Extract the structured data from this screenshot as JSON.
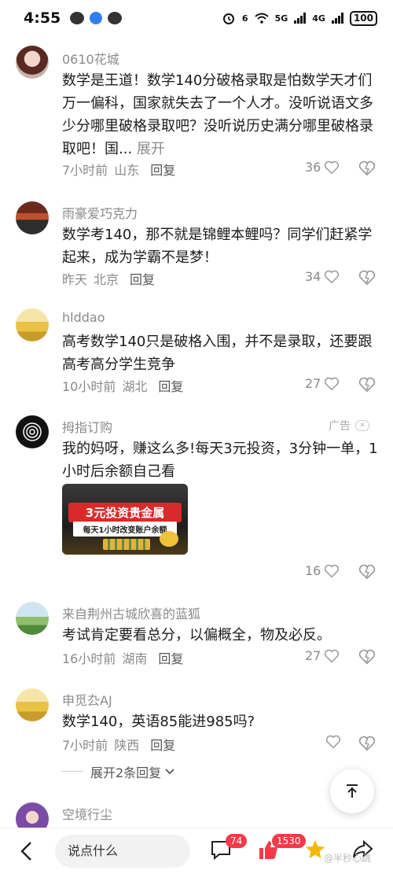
{
  "status_bar": {
    "time": "4:55",
    "network1": "6",
    "network2": "5G",
    "network3": "4G",
    "battery": "100"
  },
  "comments": [
    {
      "user": "0610花城",
      "text": "数学是王道！数学140分破格录取是怕数学天才们万一偏科，国家就失去了一个人才。没听说语文多少分哪里破格录取吧？没听说历史满分哪里破格录取吧！国...",
      "expand": "展开",
      "time": "7小时前",
      "location": "山东",
      "reply": "回复",
      "likes": "36"
    },
    {
      "user": "雨豪爱巧克力",
      "text": "数学考140，那不就是锦鲤本鲤吗？同学们赶紧学起来，成为学霸不是梦！",
      "time": "昨天",
      "location": "北京",
      "reply": "回复",
      "likes": "34"
    },
    {
      "user": "hlddao",
      "text": "高考数学140只是破格入围，并不是录取，还要跟高考高分学生竞争",
      "time": "10小时前",
      "location": "湖北",
      "reply": "回复",
      "likes": "27"
    },
    {
      "user": "拇指订购",
      "ad_label": "广告",
      "ad_close": "✕",
      "text": "我的妈呀，赚这么多!每天3元投资，3分钟一单，1小时后余额自己看",
      "ad_image_title": "3元投资贵金属",
      "ad_image_sub": "每天1小时改变账户余额",
      "likes": "16"
    },
    {
      "user": "来自荆州古城欣喜的蓝狐",
      "text": "考试肯定要看总分，以偏概全，物及必反。",
      "time": "16小时前",
      "location": "湖南",
      "reply": "回复",
      "likes": "27"
    },
    {
      "user": "申觅厹AJ",
      "text": "数学140，英语85能进985吗?",
      "time": "7小时前",
      "location": "陕西",
      "reply": "回复",
      "likes": ""
    },
    {
      "user": "空境行尘"
    }
  ],
  "expand_replies": "展开2条回复",
  "bottom_bar": {
    "input_placeholder": "说点什么",
    "comment_count": "74",
    "like_count": "1530",
    "watermark": "@半秒心跳"
  },
  "icons": [
    "heart-icon",
    "dislike-heart-icon",
    "back-icon",
    "comment-icon",
    "thumb-up-icon",
    "star-icon",
    "share-icon",
    "scroll-top-icon"
  ],
  "colors": {
    "badge": "#f23a48",
    "meta": "#8a8a8a",
    "star": "#f5b800"
  }
}
